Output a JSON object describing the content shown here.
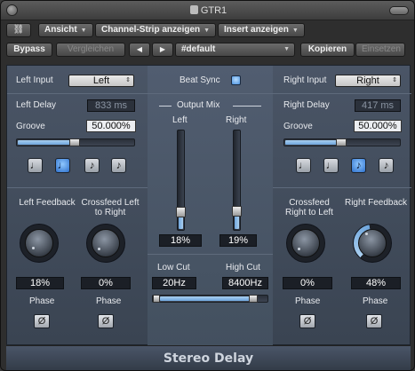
{
  "window": {
    "title": "GTR1"
  },
  "header": {
    "view_label": "Ansicht",
    "channel_strip_label": "Channel-Strip anzeigen",
    "insert_label": "Insert anzeigen",
    "bypass_label": "Bypass",
    "compare_label": "Vergleichen",
    "prev_label": "◀",
    "next_label": "▶",
    "preset_value": "#default",
    "copy_label": "Kopieren",
    "paste_label": "Einsetzen"
  },
  "left": {
    "input_label": "Left Input",
    "input_value": "Left",
    "delay_label": "Left Delay",
    "delay_value": "833 ms",
    "groove_label": "Groove",
    "groove_value": "50.000%",
    "groove_level": 0.5,
    "notes": [
      "♩",
      "♩",
      "♪",
      "♪"
    ],
    "active_note": 1,
    "feedback_label": "Left Feedback",
    "feedback_value": "18%",
    "crossfeed_label": "Crossfeed Left to Right",
    "crossfeed_value": "0%",
    "phase_label": "Phase",
    "phase_symbol": "Ø"
  },
  "middle": {
    "beat_sync_label": "Beat Sync",
    "output_mix_label": "Output Mix",
    "left_label": "Left",
    "right_label": "Right",
    "left_value": "18%",
    "right_value": "19%",
    "left_level": 0.18,
    "right_level": 0.19,
    "low_cut_label": "Low Cut",
    "high_cut_label": "High Cut",
    "low_cut_value": "20Hz",
    "high_cut_value": "8400Hz"
  },
  "right": {
    "input_label": "Right Input",
    "input_value": "Right",
    "delay_label": "Right Delay",
    "delay_value": "417 ms",
    "groove_label": "Groove",
    "groove_value": "50.000%",
    "groove_level": 0.5,
    "notes": [
      "♩",
      "♩",
      "♪",
      "♪"
    ],
    "active_note": 2,
    "crossfeed_label": "Crossfeed Right to Left",
    "crossfeed_value": "0%",
    "feedback_label": "Right Feedback",
    "feedback_value": "48%",
    "phase_label": "Phase",
    "phase_symbol": "Ø"
  },
  "footer": {
    "plugin_name": "Stereo Delay"
  },
  "colors": {
    "accent_blue": "#6fa6dd",
    "panel": "#4a5566"
  }
}
